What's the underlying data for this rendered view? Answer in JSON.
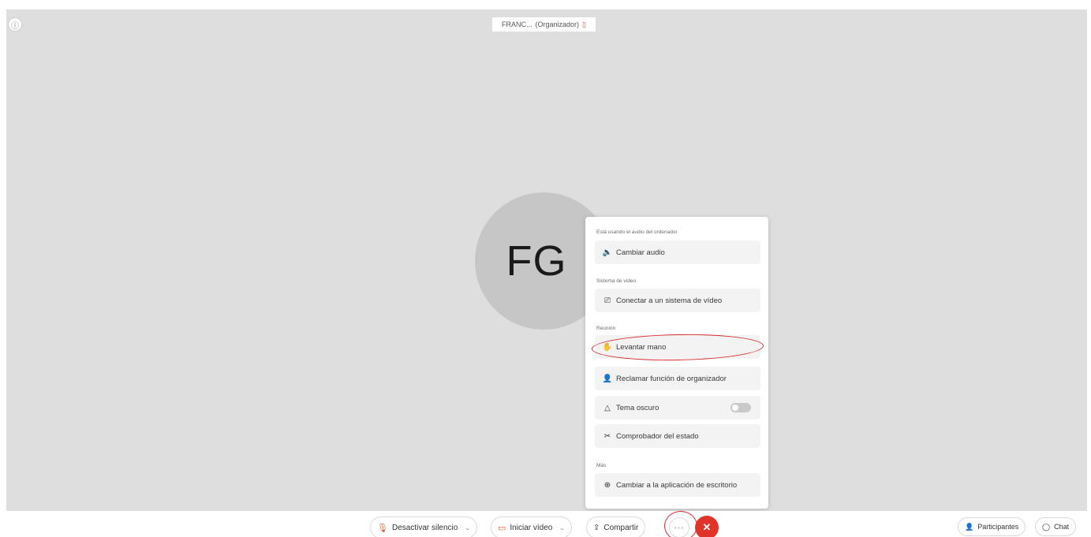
{
  "header": {
    "name_tag": "FRANC...",
    "role_tag": "(Organizador)"
  },
  "avatar": {
    "initials": "FG"
  },
  "menu": {
    "section_audio": "Está usando el audio del ordenador",
    "cambiar_audio": "Cambiar audio",
    "section_video": "Sistema de vídeo",
    "conectar_video": "Conectar a un sistema de vídeo",
    "section_reunion": "Reunión",
    "levantar_mano": "Levantar mano",
    "reclamar": "Reclamar función de organizador",
    "tema_oscuro": "Tema oscuro",
    "tema_oscuro_on": false,
    "comprobador": "Comprobador del estado",
    "section_mas": "Más",
    "cambiar_app": "Cambiar a la aplicación de escritorio"
  },
  "toolbar": {
    "unmute": "Desactivar silencio",
    "start_video": "Iniciar vídeo",
    "share": "Compartir",
    "more": "···",
    "leave": "✕",
    "participants": "Participantes",
    "chat": "Chat"
  },
  "colors": {
    "accent_red": "#e0332a",
    "annotation_red": "#d62828",
    "stage_bg": "#dedede"
  }
}
